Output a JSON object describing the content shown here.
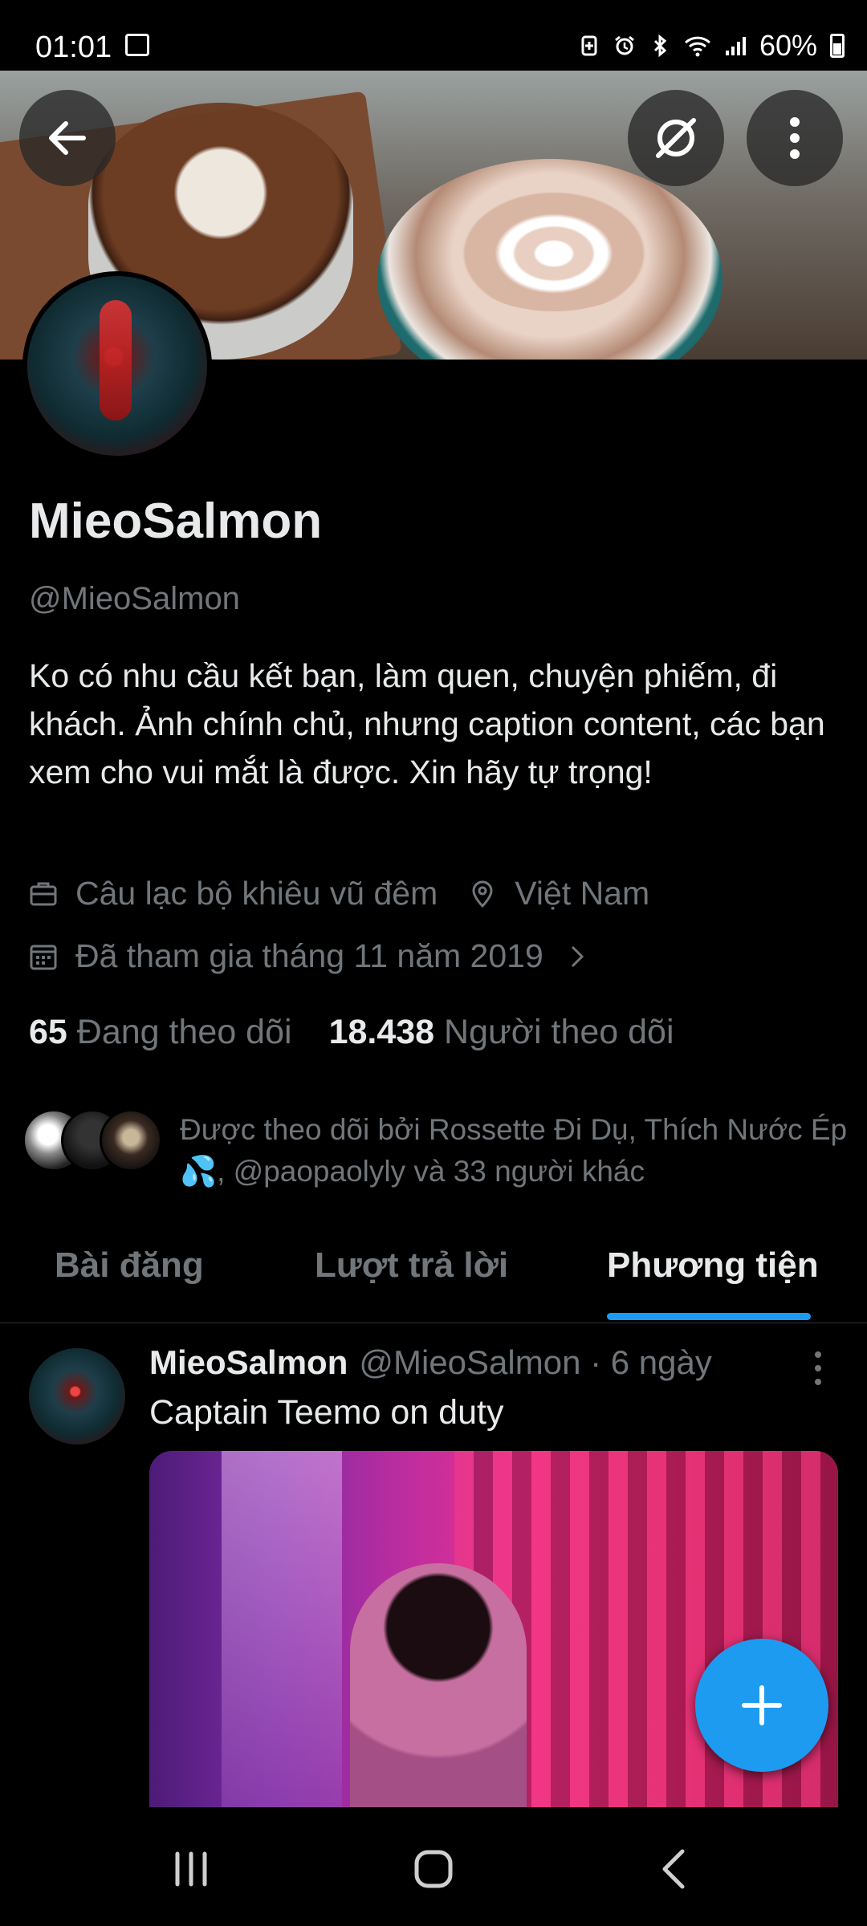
{
  "status_bar": {
    "time": "01:01",
    "battery": "60%",
    "icons": [
      "image-icon",
      "battery-saver-icon",
      "alarm-icon",
      "bluetooth-icon",
      "wifi-icon",
      "signal-icon",
      "battery-icon"
    ]
  },
  "header": {
    "back_icon": "arrow-left-icon",
    "grok_icon": "grok-icon",
    "more_icon": "more-vertical-icon"
  },
  "profile": {
    "name": "MieoSalmon",
    "handle": "@MieoSalmon",
    "bio": "Ko có nhu cầu kết bạn, làm quen, chuyện phiếm, đi khách. Ảnh chính chủ, nhưng caption content, các bạn xem cho vui mắt là được. Xin hãy tự trọng!",
    "category": "Câu lạc bộ khiêu vũ đêm",
    "location": "Việt Nam",
    "joined": "Đã tham gia tháng 11 năm 2019",
    "following_count": "65",
    "following_label": "Đang theo dõi",
    "followers_count": "18.438",
    "followers_label": "Người theo dõi",
    "followed_by": "Được theo dõi bởi Rossette Đi Dụ, Thích Nước Ép 💦, @paopaolyly và 33 người khác"
  },
  "tabs": [
    {
      "label": "Bài đăng",
      "active": false
    },
    {
      "label": "Lượt trả lời",
      "active": false
    },
    {
      "label": "Phương tiện",
      "active": true
    }
  ],
  "post": {
    "author": "MieoSalmon",
    "meta": "@MieoSalmon · 6 ngày",
    "text": "Captain Teemo on duty"
  },
  "colors": {
    "accent": "#1d9bf0",
    "background": "#000000",
    "text_primary": "#e7e9ea",
    "text_secondary": "#71767b"
  }
}
